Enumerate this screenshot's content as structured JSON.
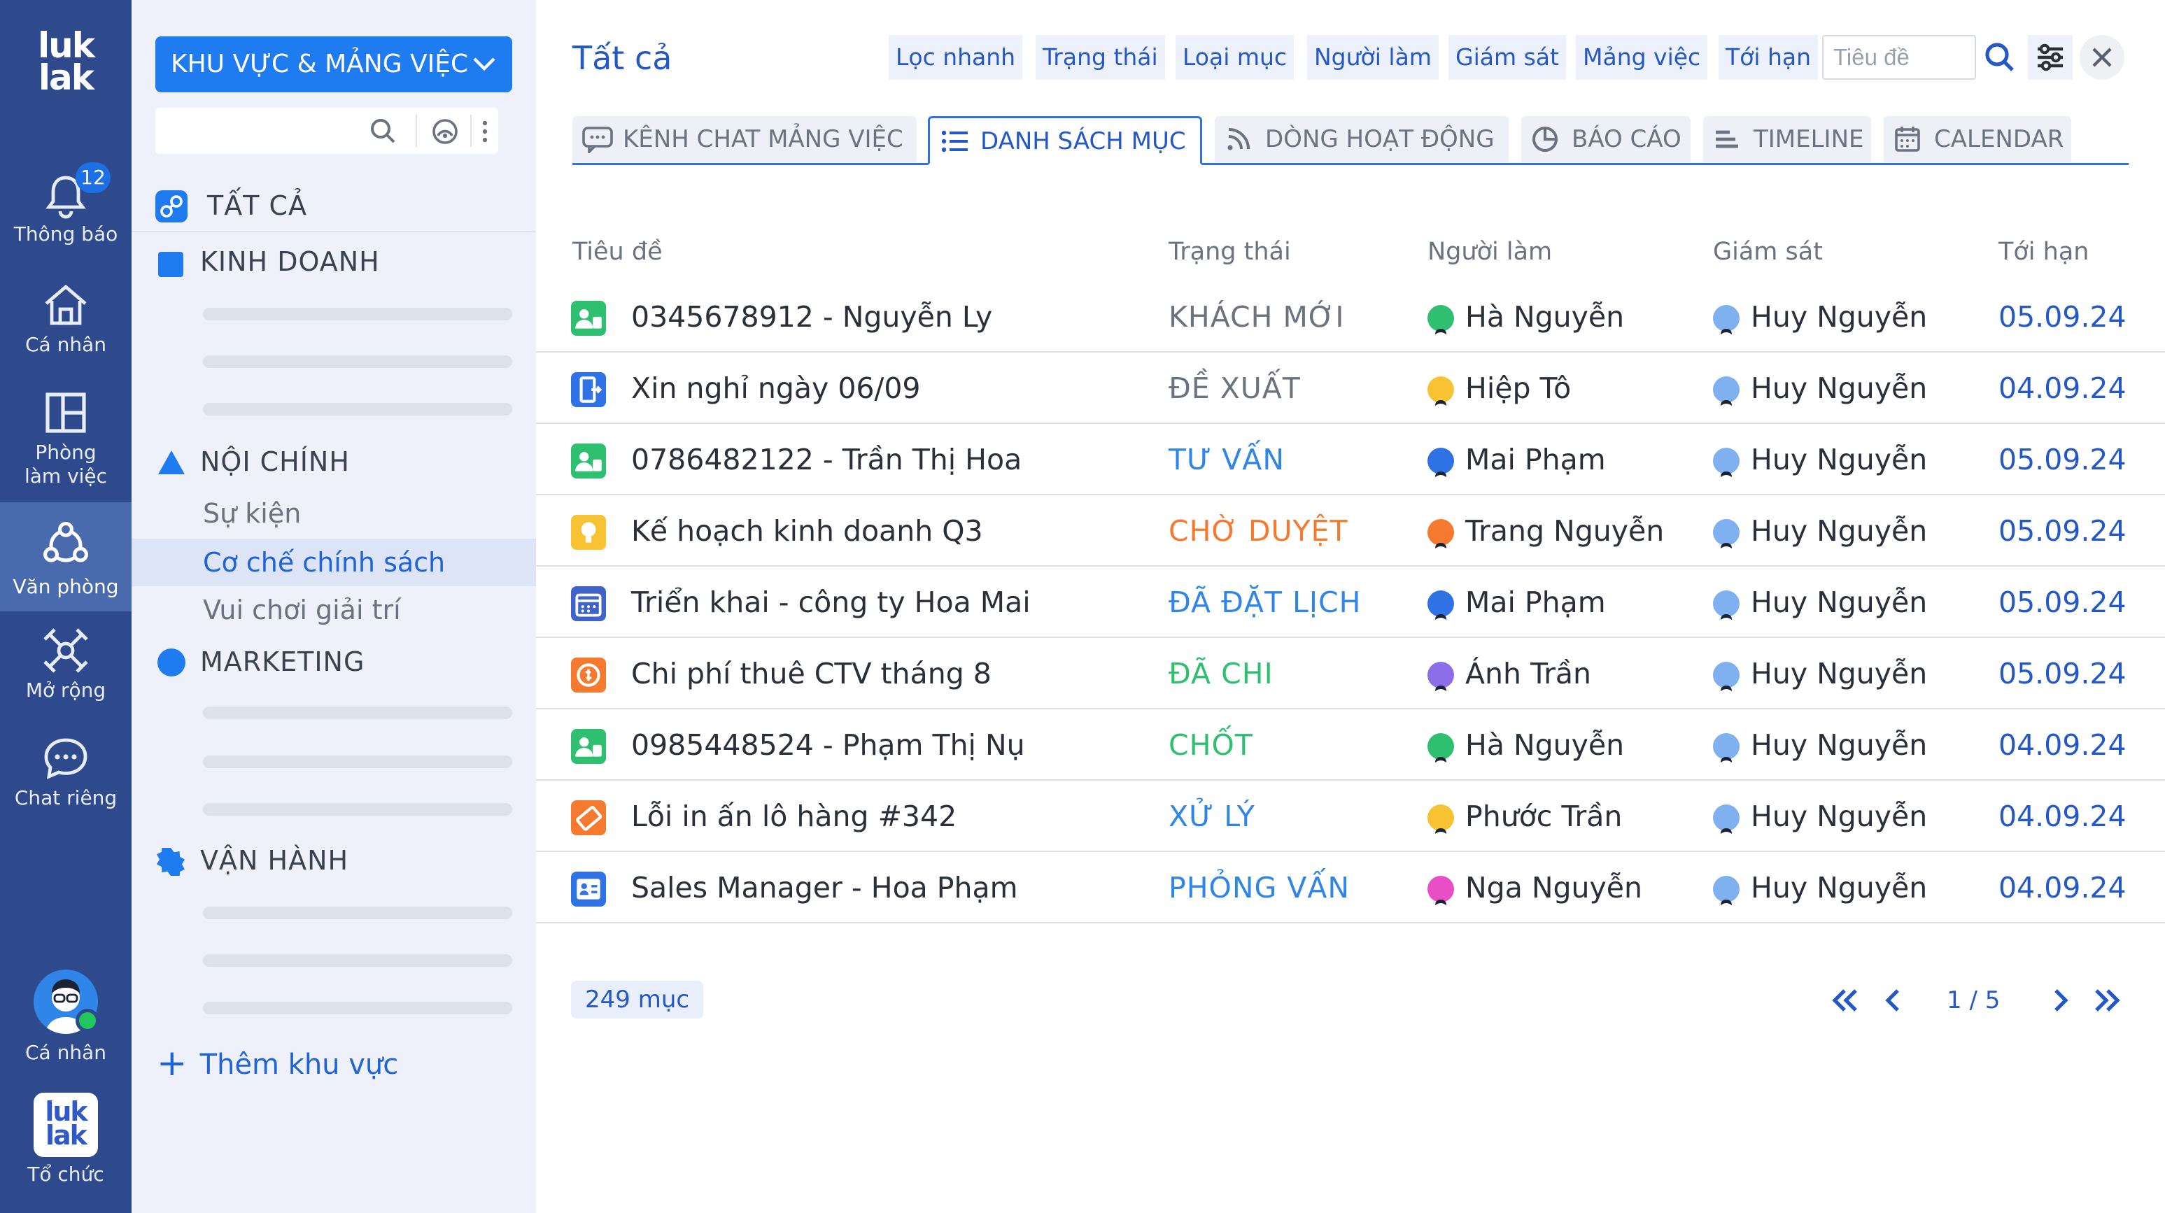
{
  "rail": {
    "logo": {
      "line1": "luk",
      "line2": "lak"
    },
    "items": [
      {
        "label": "Thông báo",
        "badge": "12"
      },
      {
        "label": "Cá nhân"
      },
      {
        "label": "Phòng làm việc"
      },
      {
        "label": "Văn phòng"
      },
      {
        "label": "Mở rộng"
      },
      {
        "label": "Chat riêng"
      }
    ],
    "profile_label": "Cá nhân",
    "org_label": "Tổ chức"
  },
  "sidebar": {
    "area_button": "KHU VỰC & MẢNG VIỆC",
    "all_label": "TẤT CẢ",
    "groups": {
      "kinh_doanh": {
        "label": "KINH DOANH",
        "color": "#1f7cf0"
      },
      "noi_chinh": {
        "label": "NỘI CHÍNH",
        "color": "#1f7cf0",
        "items": [
          "Sự kiện",
          "Cơ chế chính sách",
          "Vui chơi giải trí"
        ]
      },
      "marketing": {
        "label": "MARKETING",
        "color": "#1f7cf0"
      },
      "van_hanh": {
        "label": "VẬN HÀNH",
        "color": "#1f7cf0"
      }
    },
    "add_area": "Thêm khu vực"
  },
  "main": {
    "title": "Tất cả",
    "filters": [
      "Lọc nhanh",
      "Trạng thái",
      "Loại mục",
      "Người làm",
      "Giám sát",
      "Mảng việc",
      "Tới hạn"
    ],
    "title_input_placeholder": "Tiêu đề",
    "tabs": [
      "KÊNH CHAT MẢNG VIỆC",
      "DANH SÁCH MỤC",
      "DÒNG HOẠT ĐỘNG",
      "BÁO CÁO",
      "TIMELINE",
      "CALENDAR"
    ],
    "active_tab": "DANH SÁCH MỤC",
    "columns": {
      "title": "Tiêu đề",
      "status": "Trạng thái",
      "assignee": "Người làm",
      "supervisor": "Giám sát",
      "due": "Tới hạn"
    },
    "rows": [
      {
        "title": "0345678912 - Nguyễn Ly",
        "status": "KHÁCH MỚI",
        "status_color": "#6b7280",
        "icon": "customer-icon",
        "icon_color": "#2fbf71",
        "assignee": "Hà Nguyễn",
        "supervisor": "Huy Nguyễn",
        "due": "05.09.24"
      },
      {
        "title": "Xin nghỉ ngày 06/09",
        "status": "ĐỀ XUẤT",
        "status_color": "#6b7280",
        "icon": "leave-request-icon",
        "icon_color": "#2f72e6",
        "assignee": "Hiệp Tô",
        "supervisor": "Huy Nguyễn",
        "due": "04.09.24"
      },
      {
        "title": "0786482122 - Trần Thị Hoa",
        "status": "TƯ VẤN",
        "status_color": "#2f86e8",
        "icon": "customer-icon",
        "icon_color": "#2fbf71",
        "assignee": "Mai Phạm",
        "supervisor": "Huy Nguyễn",
        "due": "05.09.24"
      },
      {
        "title": "Kế hoạch kinh doanh Q3",
        "status": "CHỜ DUYỆT",
        "status_color": "#f5792e",
        "icon": "idea-icon",
        "icon_color": "#f7c332",
        "assignee": "Trang Nguyễn",
        "supervisor": "Huy Nguyễn",
        "due": "05.09.24"
      },
      {
        "title": "Triển khai - công ty Hoa Mai",
        "status": "ĐÃ ĐẶT LỊCH",
        "status_color": "#2f86e8",
        "icon": "calendar-icon",
        "icon_color": "#3f63c9",
        "assignee": "Mai Phạm",
        "supervisor": "Huy Nguyễn",
        "due": "05.09.24"
      },
      {
        "title": "Chi phí thuê CTV tháng 8",
        "status": "ĐÃ CHI",
        "status_color": "#2fbf71",
        "icon": "expense-icon",
        "icon_color": "#f5792e",
        "assignee": "Ánh Trần",
        "supervisor": "Huy Nguyễn",
        "due": "05.09.24"
      },
      {
        "title": "0985448524 - Phạm Thị Nụ",
        "status": "CHỐT",
        "status_color": "#2fbf71",
        "icon": "customer-icon",
        "icon_color": "#2fbf71",
        "assignee": "Hà Nguyễn",
        "supervisor": "Huy Nguyễn",
        "due": "04.09.24"
      },
      {
        "title": "Lỗi in ấn lô hàng #342",
        "status": "XỬ LÝ",
        "status_color": "#2f86e8",
        "icon": "ticket-icon",
        "icon_color": "#f5792e",
        "assignee": "Phước Trần",
        "supervisor": "Huy Nguyễn",
        "due": "04.09.24"
      },
      {
        "title": "Sales Manager - Hoa Phạm",
        "status": "PHỎNG VẤN",
        "status_color": "#2f86e8",
        "icon": "candidate-icon",
        "icon_color": "#2f72e6",
        "assignee": "Nga Nguyễn",
        "supervisor": "Huy Nguyễn",
        "due": "04.09.24"
      }
    ],
    "item_count": "249 mục",
    "pagination": "1 / 5"
  }
}
